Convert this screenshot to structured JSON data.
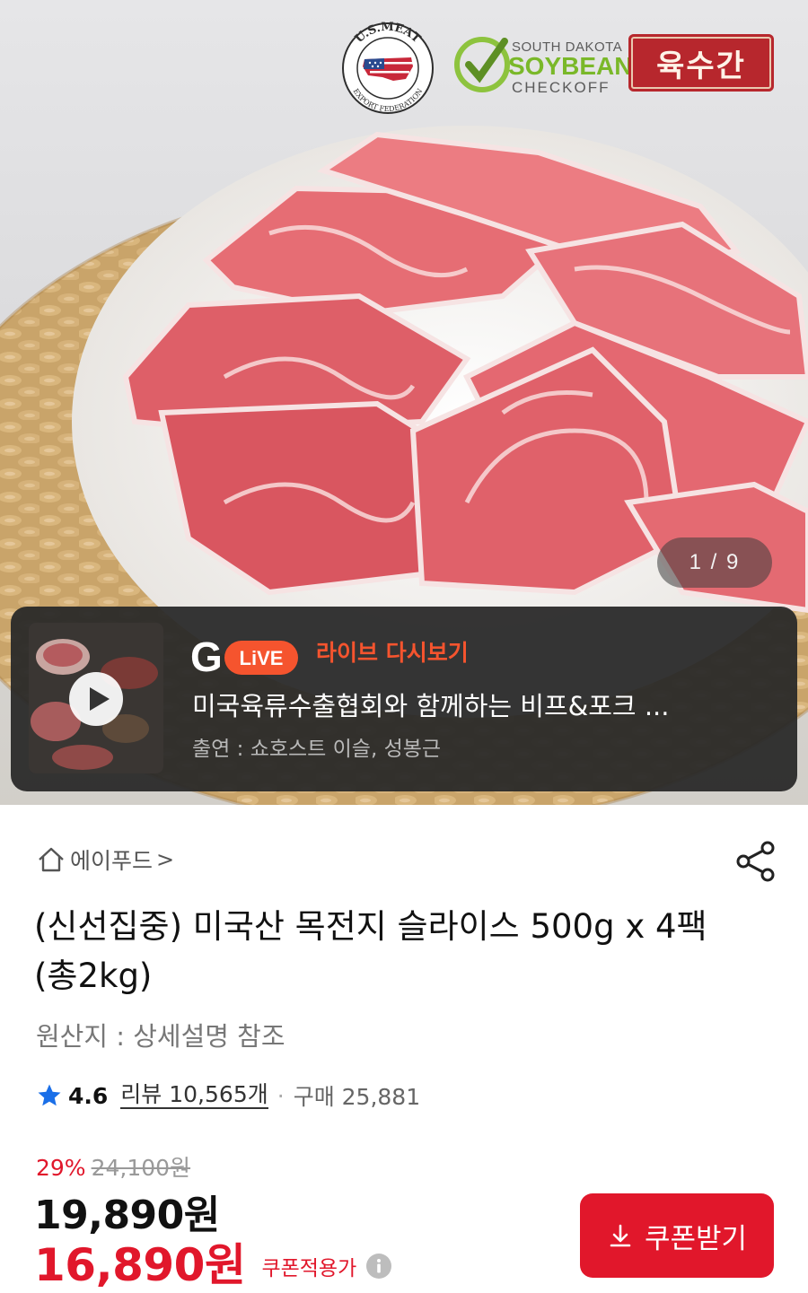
{
  "hero": {
    "logos": {
      "usmeat_top": "U.S.MEAT",
      "usmeat_bottom": "EXPORT FEDERATION",
      "soy_line1": "SOUTH DAKOTA",
      "soy_line2": "SOYBEAN",
      "soy_line3": "CHECKOFF",
      "yuksugan": "육수간"
    },
    "counter": "1 / 9"
  },
  "live": {
    "logo_g": "G",
    "logo_live": "LiVE",
    "replay_label": "라이브 다시보기",
    "title": "미국육류수출협회와 함께하는 비프&포크 ...",
    "cast": "출연 : 쇼호스트 이슬, 성봉근"
  },
  "seller": {
    "name": "에이푸드",
    "chevron": ">"
  },
  "product": {
    "title": "(신선집중) 미국산 목전지 슬라이스 500g x 4팩 (총2kg)",
    "origin": "원산지 : 상세설명 참조"
  },
  "rating": {
    "score": "4.6",
    "review": "리뷰 10,565개",
    "separator": "·",
    "purchases": "구매 25,881"
  },
  "pricing": {
    "discount_pct": "29%",
    "original_price": "24,100원",
    "price": "19,890원",
    "coupon_price": "16,890원",
    "coupon_label": "쿠폰적용가"
  },
  "coupon_button": {
    "label": "쿠폰받기"
  },
  "colors": {
    "accent_red": "#e1172b",
    "live_orange": "#f5542e",
    "star_blue": "#1a6fe8"
  },
  "icons": [
    "home-icon",
    "chevron-right-icon",
    "share-icon",
    "star-icon",
    "info-icon",
    "download-icon",
    "play-icon"
  ]
}
